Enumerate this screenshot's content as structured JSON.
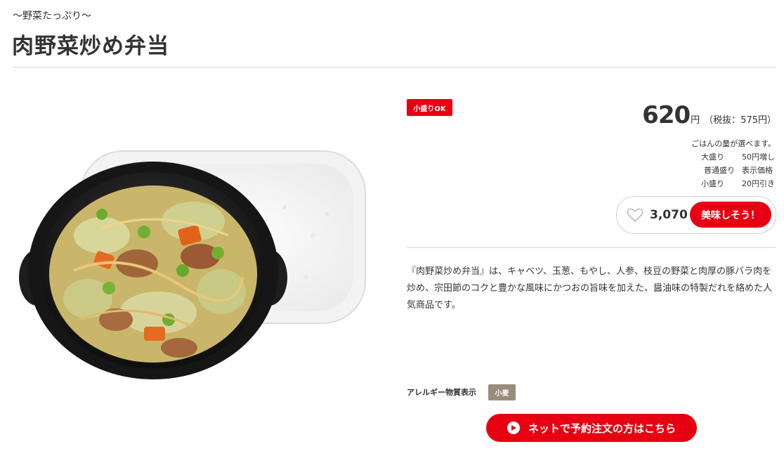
{
  "product": {
    "subtitle": "〜野菜たっぷり〜",
    "title": "肉野菜炒め弁当",
    "badge": "小盛りOK",
    "price": "620",
    "price_unit": "円",
    "price_tax": "（税抜：575円）",
    "rice_note": "ごはんの量が選べます。",
    "rice_options": [
      {
        "size": "大盛り",
        "price": "50円増し"
      },
      {
        "size": "普通盛り",
        "price": "表示価格"
      },
      {
        "size": "小盛り",
        "price": "20円引き"
      }
    ],
    "likes": "3,070",
    "like_button": "美味しそう！",
    "description": "『肉野菜炒め弁当』は、キャベツ、玉葱、もやし、人参、枝豆の野菜と肉厚の豚バラ肉を炒め、宗田節のコクと豊かな風味にかつおの旨味を加えた、醤油味の特製だれを絡めた人気商品です。",
    "allergy_label": "アレルギー物質表示",
    "allergens": [
      "小麦"
    ],
    "order_button": "ネットで予約注文の方はこちら"
  },
  "colors": {
    "accent": "#e60012",
    "allergen_tag": "#9b8b7a",
    "divider": "#d9d9d9"
  },
  "icons": {
    "heart": "heart-icon",
    "order": "play-circle-icon"
  }
}
